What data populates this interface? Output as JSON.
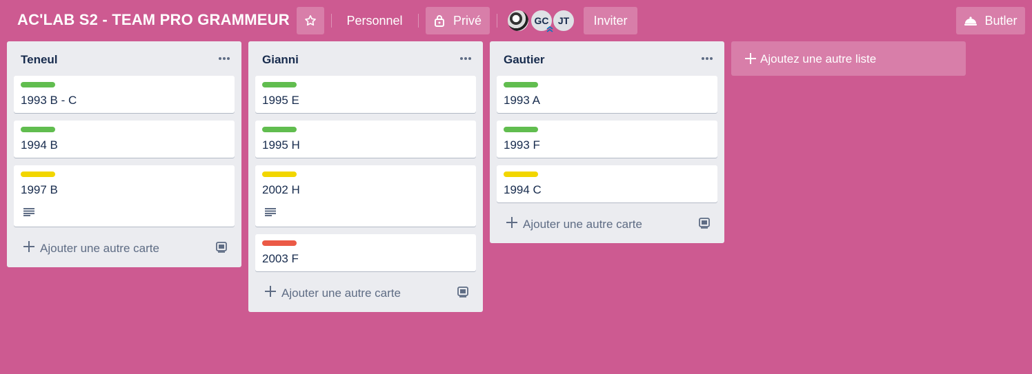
{
  "header": {
    "board_title": "AC'LAB S2 - TEAM PRO GRAMMEUR",
    "star_icon": "star-icon",
    "team_label": "Personnel",
    "visibility_label": "Privé",
    "lock_icon": "lock-icon",
    "members": [
      {
        "initials": "",
        "kind": "photo"
      },
      {
        "initials": "GC",
        "kind": "initials"
      },
      {
        "initials": "JT",
        "kind": "initials"
      }
    ],
    "invite_label": "Inviter",
    "butler_label": "Butler",
    "butler_icon": "bell-icon"
  },
  "colors": {
    "board_background": "#cd5a91",
    "label_green": "#61bd4f",
    "label_yellow": "#f2d600",
    "label_red": "#eb5a46"
  },
  "lists": [
    {
      "title": "Teneul",
      "cards": [
        {
          "title": "1993 B - C",
          "label_color": "green",
          "has_description": false
        },
        {
          "title": "1994 B",
          "label_color": "green",
          "has_description": false
        },
        {
          "title": "1997 B",
          "label_color": "yellow",
          "has_description": true
        }
      ],
      "add_card_label": "Ajouter une autre carte"
    },
    {
      "title": "Gianni",
      "cards": [
        {
          "title": "1995 E",
          "label_color": "green",
          "has_description": false
        },
        {
          "title": "1995 H",
          "label_color": "green",
          "has_description": false
        },
        {
          "title": "2002 H",
          "label_color": "yellow",
          "has_description": true
        },
        {
          "title": "2003 F",
          "label_color": "red",
          "has_description": false
        }
      ],
      "add_card_label": "Ajouter une autre carte"
    },
    {
      "title": "Gautier",
      "cards": [
        {
          "title": "1993 A",
          "label_color": "green",
          "has_description": false
        },
        {
          "title": "1993 F",
          "label_color": "green",
          "has_description": false
        },
        {
          "title": "1994 C",
          "label_color": "yellow",
          "has_description": false
        }
      ],
      "add_card_label": "Ajouter une autre carte"
    }
  ],
  "add_list_label": "Ajoutez une autre liste"
}
